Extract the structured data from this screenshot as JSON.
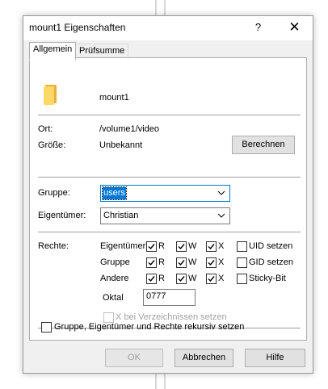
{
  "window": {
    "title": "mount1 Eigenschaften",
    "help_glyph": "?",
    "close_glyph": "✕"
  },
  "tabs": [
    {
      "label": "Allgemein",
      "active": true
    },
    {
      "label": "Prüfsumme",
      "active": false
    }
  ],
  "general": {
    "name": "mount1",
    "icon": "folder-icon",
    "location_label": "Ort:",
    "location_value": "/volume1/video",
    "size_label": "Größe:",
    "size_value": "Unbekannt",
    "calculate_button": "Berechnen"
  },
  "ownership": {
    "group_label": "Gruppe:",
    "group_value": "users",
    "owner_label": "Eigentümer:",
    "owner_value": "Christian"
  },
  "permissions": {
    "label": "Rechte:",
    "rows": [
      {
        "name": "Eigentümer",
        "r": true,
        "w": true,
        "x": true,
        "extra": "UID setzen",
        "extra_checked": false
      },
      {
        "name": "Gruppe",
        "r": true,
        "w": true,
        "x": true,
        "extra": "GID setzen",
        "extra_checked": false
      },
      {
        "name": "Andere",
        "r": true,
        "w": true,
        "x": true,
        "extra": "Sticky-Bit",
        "extra_checked": false
      }
    ],
    "letters": {
      "r": "R",
      "w": "W",
      "x": "X"
    },
    "octal_label": "Oktal",
    "octal_value": "0777",
    "dir_exec_label": "X bei Verzeichnissen setzen",
    "dir_exec_checked": false
  },
  "recursive": {
    "label": "Gruppe, Eigentümer und Rechte rekursiv setzen",
    "checked": false
  },
  "buttons": {
    "ok": "OK",
    "cancel": "Abbrechen",
    "help": "Hilfe"
  },
  "colors": {
    "accent": "#0078d7",
    "folder": "#ffd766",
    "dialog_bg": "#f0f0f0"
  }
}
